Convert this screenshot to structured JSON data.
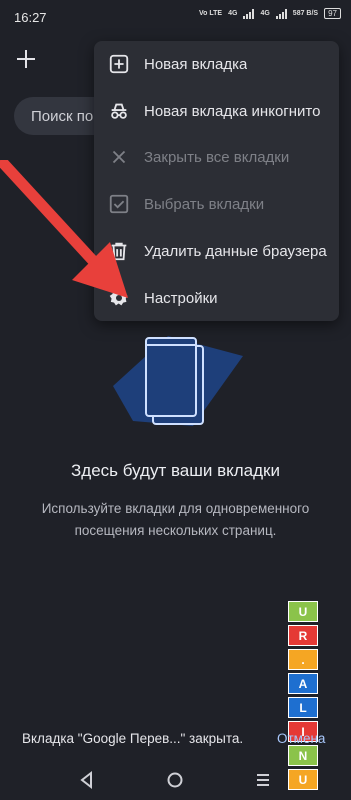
{
  "status_bar": {
    "time": "16:27",
    "indicators": [
      "Vo LTE",
      "4G",
      "4G",
      "587 B/S"
    ],
    "battery": "97"
  },
  "toolbar": {
    "new_tab_icon": "plus-icon"
  },
  "search": {
    "text": "Поиск по"
  },
  "menu": {
    "items": [
      {
        "label": "Новая вкладка",
        "icon": "add-box-icon",
        "enabled": true
      },
      {
        "label": "Новая вкладка инкогнито",
        "icon": "incognito-icon",
        "enabled": true
      },
      {
        "label": "Закрыть все вкладки",
        "icon": "close-icon",
        "enabled": false
      },
      {
        "label": "Выбрать вкладки",
        "icon": "checkbox-icon",
        "enabled": false
      },
      {
        "label": "Удалить данные браузера",
        "icon": "trash-icon",
        "enabled": true
      },
      {
        "label": "Настройки",
        "icon": "gear-icon",
        "enabled": true
      }
    ]
  },
  "empty_state": {
    "title": "Здесь будут ваши вкладки",
    "subtitle": "Используйте вкладки для одновременного посещения нескольких страниц."
  },
  "snackbar": {
    "text": "Вкладка \"Google Перев...\" закрыта.",
    "action": "Отмена"
  },
  "watermark": {
    "letters": [
      "U",
      "R",
      ".",
      "A",
      "L",
      "I",
      "N",
      "U"
    ]
  },
  "colors": {
    "background": "#1f2128",
    "menu": "#2c2e35",
    "arrow": "#e8403b",
    "illustration": "#1e3f7a",
    "watermark": [
      "#8bc34a",
      "#e53935",
      "#f5a623",
      "#1e6fd0",
      "#1e6fd0",
      "#e53935",
      "#8bc34a",
      "#f5a623"
    ]
  }
}
